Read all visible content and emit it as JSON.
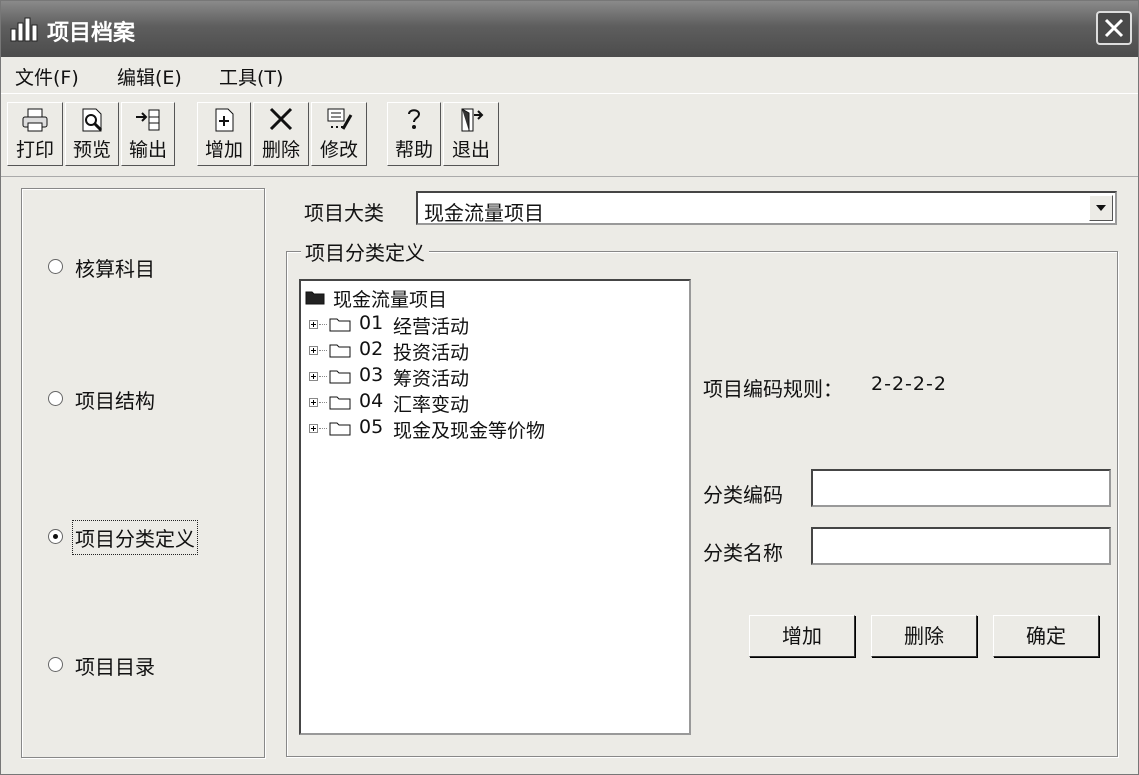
{
  "window": {
    "title": "项目档案"
  },
  "menu": [
    {
      "label": "文件(F)"
    },
    {
      "label": "编辑(E)"
    },
    {
      "label": "工具(T)"
    }
  ],
  "toolbar": [
    {
      "label": "打印",
      "icon": "printer-icon"
    },
    {
      "label": "预览",
      "icon": "preview-icon"
    },
    {
      "label": "输出",
      "icon": "export-icon"
    },
    {
      "label": "增加",
      "icon": "add-icon"
    },
    {
      "label": "删除",
      "icon": "delete-icon"
    },
    {
      "label": "修改",
      "icon": "edit-icon"
    },
    {
      "label": "帮助",
      "icon": "help-icon"
    },
    {
      "label": "退出",
      "icon": "exit-icon"
    }
  ],
  "left_options": [
    {
      "label": "核算科目",
      "checked": false
    },
    {
      "label": "项目结构",
      "checked": false
    },
    {
      "label": "项目分类定义",
      "checked": true
    },
    {
      "label": "项目目录",
      "checked": false
    }
  ],
  "category": {
    "label": "项目大类",
    "value": "现金流量项目"
  },
  "group": {
    "title": "项目分类定义"
  },
  "tree": {
    "root": "现金流量项目",
    "children": [
      {
        "code": "01",
        "name": "经营活动"
      },
      {
        "code": "02",
        "name": "投资活动"
      },
      {
        "code": "03",
        "name": "筹资活动"
      },
      {
        "code": "04",
        "name": "汇率变动"
      },
      {
        "code": "05",
        "name": "现金及现金等价物"
      }
    ]
  },
  "coding_rule": {
    "label": "项目编码规则：",
    "value": "2-2-2-2"
  },
  "fields": {
    "code": {
      "label": "分类编码",
      "value": ""
    },
    "name": {
      "label": "分类名称",
      "value": ""
    }
  },
  "buttons": {
    "add": "增加",
    "delete": "删除",
    "ok": "确定"
  },
  "colors": {
    "titlebar": "#5e5e5e",
    "window_bg": "#ecebe6"
  }
}
